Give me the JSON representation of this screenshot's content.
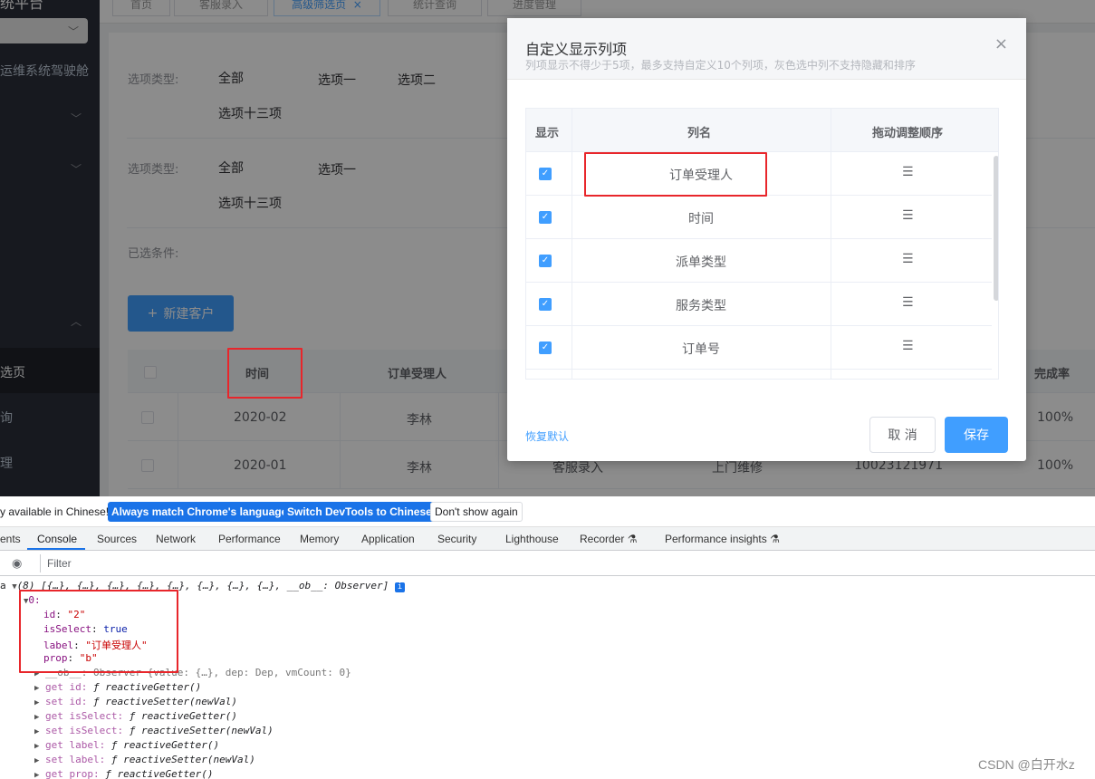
{
  "sidebar": {
    "title": "统平台",
    "menu_item_ops": "运维系统驾驶舱",
    "active_item": "选页",
    "item_query": "询",
    "item_manage": "理"
  },
  "tabs": [
    {
      "label": "首页"
    },
    {
      "label": "客服录入"
    },
    {
      "label": "高级筛选页"
    },
    {
      "label": "统计查询"
    },
    {
      "label": "进度管理"
    }
  ],
  "tab_close": "×",
  "filters": {
    "row1": {
      "label": "选项类型:",
      "options": [
        "全部",
        "选项一",
        "选项二"
      ],
      "extra": "选项十三项"
    },
    "row2": {
      "label": "选项类型:",
      "options": [
        "全部",
        "选项一"
      ],
      "extra": "选项十三项"
    },
    "selected_label": "已选条件:"
  },
  "new_button": {
    "icon": "+",
    "label": "新建客户"
  },
  "table": {
    "headers": {
      "time": "时间",
      "assignee": "订单受理人",
      "rate": "完成率"
    },
    "rows": [
      {
        "time": "2020-02",
        "assignee": "李林",
        "rate": "100%"
      },
      {
        "time": "2020-01",
        "assignee": "李林",
        "type": "客服录入",
        "service": "上门维修",
        "order": "10023121971",
        "rate": "100%"
      }
    ]
  },
  "modal": {
    "title": "自定义显示列项",
    "subtitle": "列项显示不得少于5项，最多支持自定义10个列项，灰色选中列不支持隐藏和排序",
    "close": "×",
    "headers": {
      "show": "显示",
      "name": "列名",
      "drag": "拖动调整顺序"
    },
    "rows": [
      {
        "label": "订单受理人"
      },
      {
        "label": "时间"
      },
      {
        "label": "派单类型"
      },
      {
        "label": "服务类型"
      },
      {
        "label": "订单号"
      }
    ],
    "restore": "恢复默认",
    "cancel": "取 消",
    "save": "保存"
  },
  "devtools": {
    "info_text": "y available in Chinese!",
    "btn_match": "Always match Chrome's language",
    "btn_switch": "Switch DevTools to Chinese",
    "btn_dont": "Don't show again",
    "tabs": [
      "ents",
      "Console",
      "Sources",
      "Network",
      "Performance",
      "Memory",
      "Application",
      "Security",
      "Lighthouse",
      "Recorder",
      "Performance insights"
    ],
    "filter_placeholder": "Filter",
    "console": {
      "line0_prefix": "a",
      "line0": "(8) [{…}, {…}, {…}, {…}, {…}, {…}, {…}, {…}, __ob__: Observer]",
      "index": "0:",
      "props": [
        {
          "key": "id",
          "value": "\"2\""
        },
        {
          "key": "isSelect",
          "value": "true"
        },
        {
          "key": "label",
          "value": "\"订单受理人\""
        },
        {
          "key": "prop",
          "value": "\"b\""
        }
      ],
      "ob_line": "__ob__: Observer {value: {…}, dep: Dep, vmCount: 0}",
      "accessors": [
        {
          "kind": "get id:",
          "fn": "ƒ reactiveGetter()"
        },
        {
          "kind": "set id:",
          "fn": "ƒ reactiveSetter(newVal)"
        },
        {
          "kind": "get isSelect:",
          "fn": "ƒ reactiveGetter()"
        },
        {
          "kind": "set isSelect:",
          "fn": "ƒ reactiveSetter(newVal)"
        },
        {
          "kind": "get label:",
          "fn": "ƒ reactiveGetter()"
        },
        {
          "kind": "set label:",
          "fn": "ƒ reactiveSetter(newVal)"
        },
        {
          "kind": "get prop:",
          "fn": "ƒ reactiveGetter()"
        }
      ]
    }
  },
  "watermark": "CSDN @白开水z",
  "colors": {
    "primary": "#409eff",
    "highlight": "#e8262b",
    "sidebar": "#2b2f3a"
  }
}
